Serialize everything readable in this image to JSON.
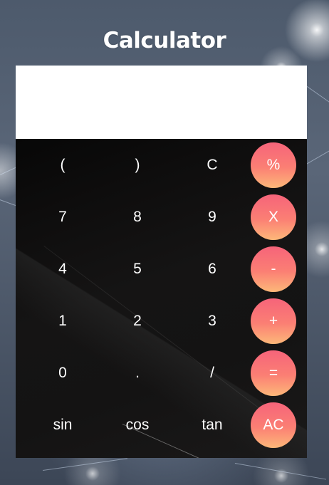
{
  "app": {
    "title": "Calculator"
  },
  "display": {
    "value": "",
    "placeholder": ""
  },
  "keypad": {
    "row1": [
      "(",
      ")",
      "C",
      "%"
    ],
    "row2": [
      "7",
      "8",
      "9",
      "X"
    ],
    "row3": [
      "4",
      "5",
      "6",
      "-"
    ],
    "row4": [
      "1",
      "2",
      "3",
      "+"
    ],
    "row5": [
      "0",
      ".",
      "/",
      "="
    ],
    "row6": [
      "sin",
      "cos",
      "tan",
      "AC"
    ]
  },
  "colors": {
    "operator_gradient_top": "#f6647a",
    "operator_gradient_bottom": "#fdb879",
    "keypad_background": "#141313",
    "display_background": "#ffffff",
    "key_text": "#ffffff"
  }
}
